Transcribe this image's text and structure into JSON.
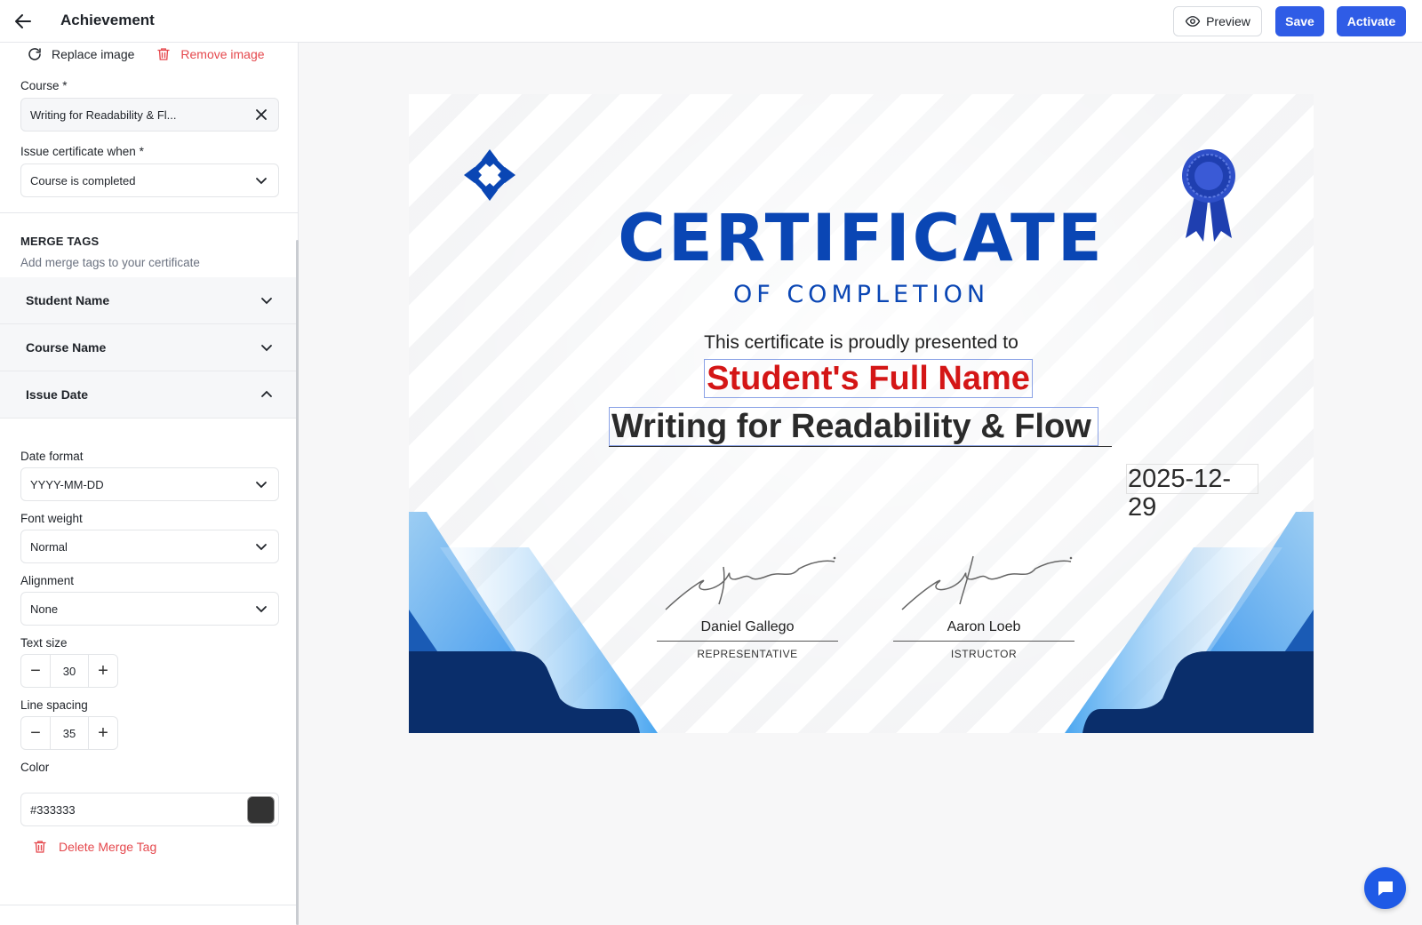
{
  "header": {
    "title": "Achievement",
    "preview_label": "Preview",
    "save_label": "Save",
    "activate_label": "Activate"
  },
  "image_actions": {
    "replace_label": "Replace image",
    "remove_label": "Remove image"
  },
  "course_field": {
    "label": "Course *",
    "value": "Writing for Readability & Fl..."
  },
  "issue_when_field": {
    "label": "Issue certificate when *",
    "value": "Course is completed"
  },
  "merge_tags": {
    "title": "MERGE TAGS",
    "subtitle": "Add merge tags to your certificate",
    "items": [
      {
        "label": "Student Name",
        "expanded": false
      },
      {
        "label": "Course Name",
        "expanded": false
      },
      {
        "label": "Issue Date",
        "expanded": true
      }
    ]
  },
  "issue_date_settings": {
    "date_format": {
      "label": "Date format",
      "value": "YYYY-MM-DD"
    },
    "font_weight": {
      "label": "Font weight",
      "value": "Normal"
    },
    "alignment": {
      "label": "Alignment",
      "value": "None"
    },
    "text_size": {
      "label": "Text size",
      "value": "30"
    },
    "line_spacing": {
      "label": "Line spacing",
      "value": "35"
    },
    "color": {
      "label": "Color",
      "value": "#333333"
    },
    "delete_label": "Delete Merge Tag"
  },
  "certificate": {
    "title": "CERTIFICATE",
    "subtitle": "OF COMPLETION",
    "presented_text": "This certificate is proudly presented  to",
    "student_name": "Student's Full Name",
    "course_name": "Writing for Readability & Flow",
    "issue_date": "2025-12-29",
    "signatures": [
      {
        "name": "Daniel Gallego",
        "role": "REPRESENTATIVE"
      },
      {
        "name": "Aaron Loeb",
        "role": "ISTRUCTOR"
      }
    ]
  },
  "colors": {
    "accent": "#2f5ce6",
    "certificate_blue": "#0a46b4",
    "student_name_red": "#d41616",
    "danger": "#e5484d",
    "merge_text": "#333333"
  }
}
